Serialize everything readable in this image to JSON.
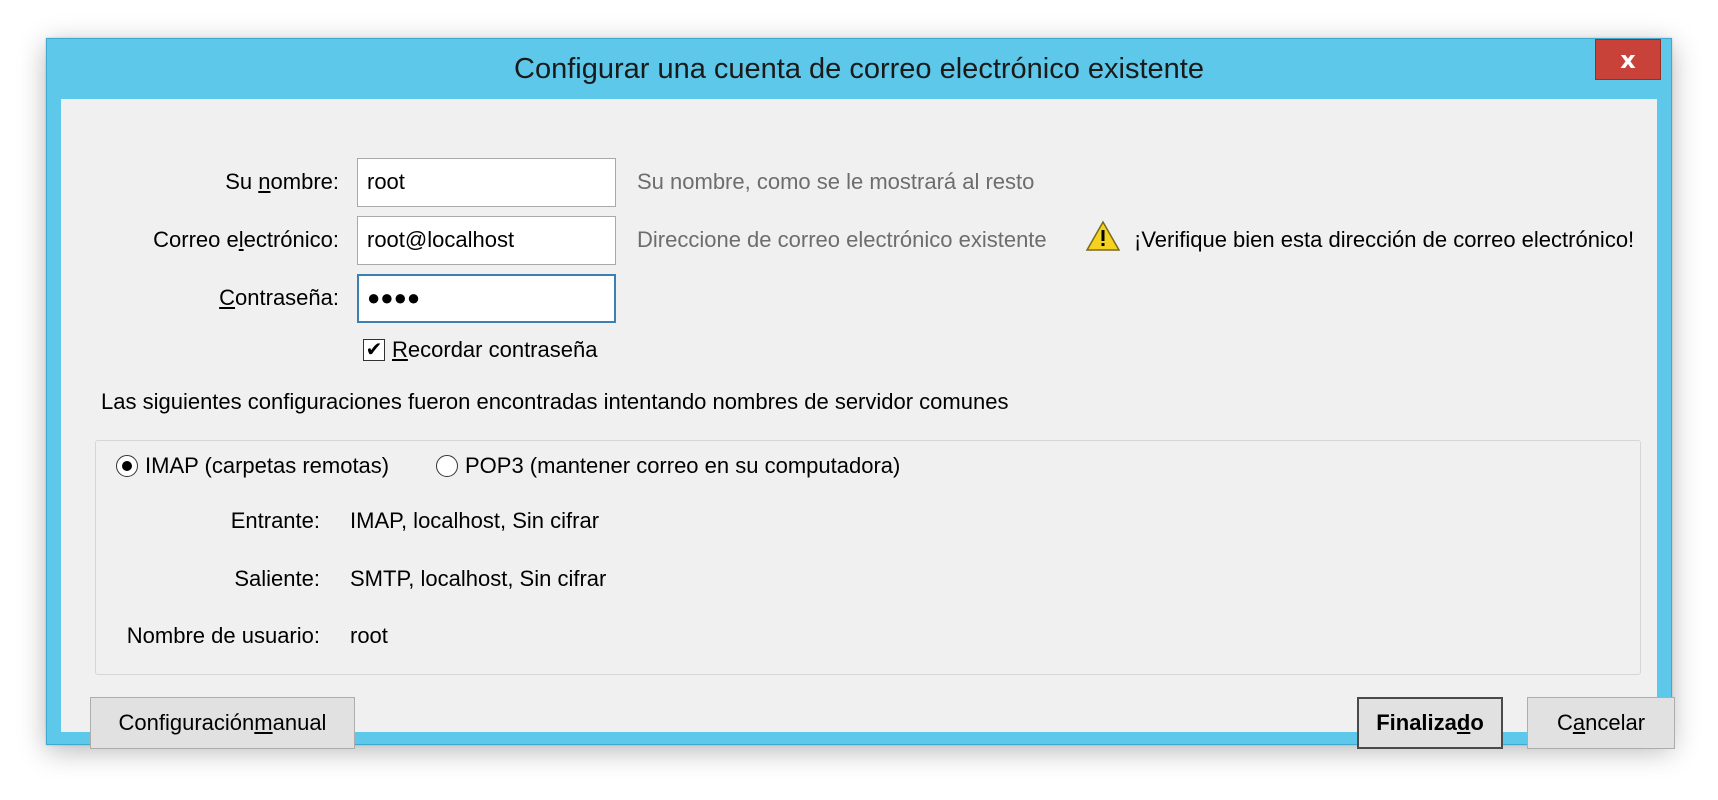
{
  "window": {
    "title": "Configurar una cuenta de correo electrónico existente",
    "close_glyph": "x",
    "accent_color": "#5dc8ea",
    "close_color": "#c9423a"
  },
  "form": {
    "name": {
      "label_pre": "Su ",
      "label_key": "n",
      "label_post": "ombre:",
      "value": "root",
      "hint": "Su nombre, como se le mostrará al resto"
    },
    "email": {
      "label_pre": "Correo e",
      "label_key": "l",
      "label_post": "ectrónico:",
      "value": "root@localhost",
      "hint": "Direccione de correo electrónico existente",
      "warning_icon": "warning-triangle-icon",
      "warning": "¡Verifique bien esta dirección de correo electrónico!"
    },
    "password": {
      "label_key": "C",
      "label_post": "ontraseña:",
      "value": "●●●●"
    },
    "remember": {
      "checked": true,
      "check_glyph": "✔",
      "label_key": "R",
      "label_post": "ecordar contraseña"
    }
  },
  "info_line": "Las siguientes configuraciones fueron encontradas intentando nombres de servidor comunes",
  "config": {
    "protocols": [
      {
        "label": "IMAP (carpetas remotas)",
        "selected": true
      },
      {
        "label": "POP3 (mantener correo en su computadora)",
        "selected": false
      }
    ],
    "incoming": {
      "label": "Entrante:",
      "value": "IMAP, localhost, Sin cifrar"
    },
    "outgoing": {
      "label": "Saliente:",
      "value": "SMTP, localhost, Sin cifrar"
    },
    "username": {
      "label": "Nombre de usuario:",
      "value": "root"
    }
  },
  "buttons": {
    "manual": {
      "pre": "Configuración ",
      "key": "m",
      "post": "anual"
    },
    "done": {
      "pre": "Finaliza",
      "key": "d",
      "post": "o"
    },
    "cancel": {
      "pre": "C",
      "key": "a",
      "post": "ncelar"
    }
  }
}
